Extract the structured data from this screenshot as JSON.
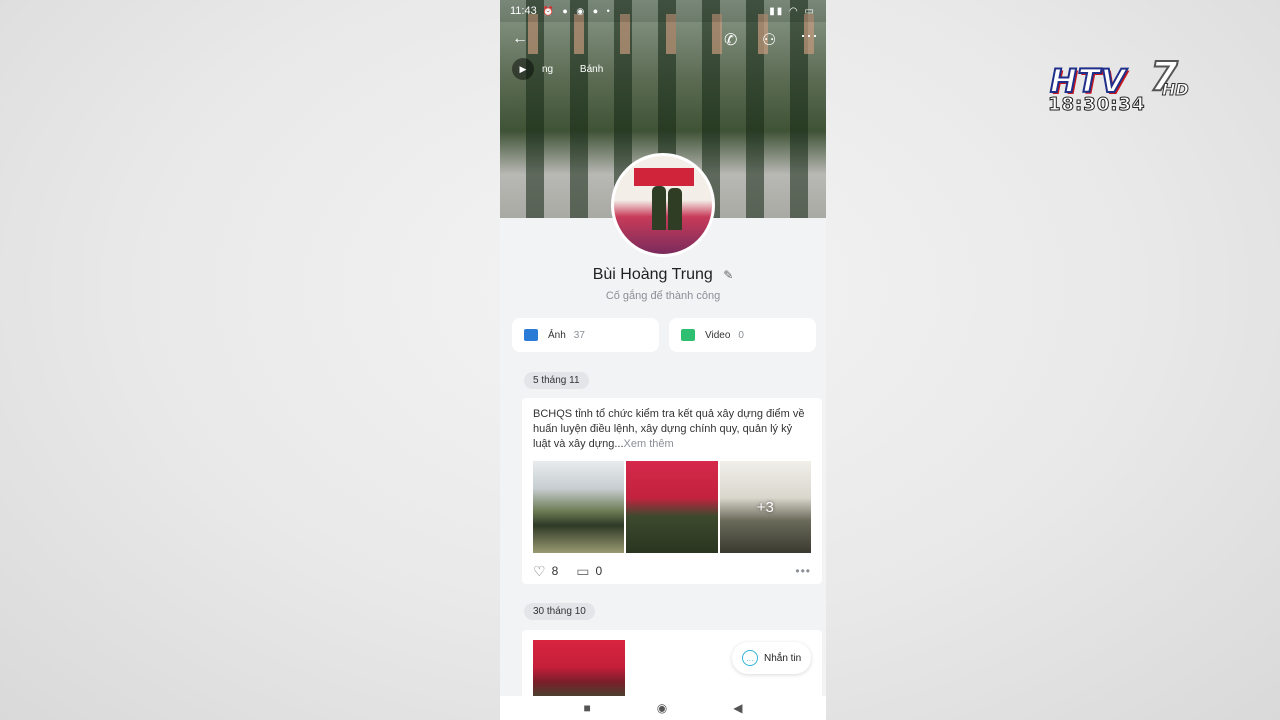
{
  "overlay": {
    "channel_logo": "HTV7 HD",
    "clock": "18:30:34"
  },
  "status_bar": {
    "time": "11:43",
    "notification_icons": [
      "alarm-icon",
      "messenger-icon",
      "shield-icon",
      "facebook-icon",
      "dot-icon"
    ],
    "right_icons": [
      "signal-icon",
      "wifi-icon",
      "battery-icon"
    ]
  },
  "header": {
    "actions": [
      "back-icon",
      "call-icon",
      "add-friend-icon",
      "more-icon"
    ],
    "music_songs": [
      "ng",
      "Bánh"
    ]
  },
  "profile": {
    "name": "Bùi Hoàng Trung",
    "bio": "Cố gắng để thành công"
  },
  "media_tabs": [
    {
      "label": "Ảnh",
      "count": "37",
      "icon": "photo-icon",
      "color": "#2a7bd6"
    },
    {
      "label": "Video",
      "count": "0",
      "icon": "video-icon",
      "color": "#2fbf71"
    }
  ],
  "timeline": [
    {
      "date": "5 tháng 11",
      "text": "BCHQS tỉnh tổ chức kiểm tra kết quả xây dựng điểm về huấn luyện điều lệnh, xây dựng chính quy, quản lý kỷ luật và xây dựng...",
      "more_label": "Xem thêm",
      "extra_photos": "+3",
      "likes": "8",
      "comments": "0"
    },
    {
      "date": "30 tháng 10"
    }
  ],
  "message_button": {
    "label": "Nhắn tin"
  },
  "nav_bar": [
    "recents-icon",
    "home-icon",
    "back-triangle-icon"
  ]
}
